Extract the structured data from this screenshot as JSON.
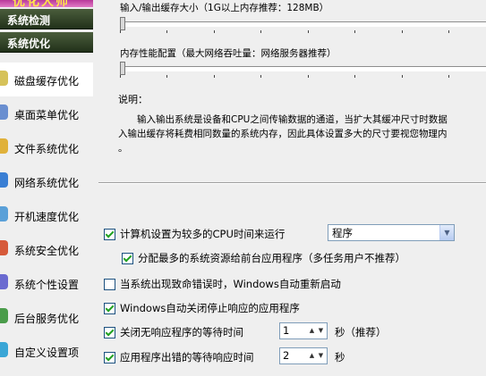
{
  "sidebar": {
    "categories": [
      "系统检测",
      "系统优化"
    ],
    "items": [
      {
        "label": "磁盘缓存优化",
        "icon": "disk-icon",
        "color": "#d6c25a"
      },
      {
        "label": "桌面菜单优化",
        "icon": "desktop-icon",
        "color": "#6a8fd0"
      },
      {
        "label": "文件系统优化",
        "icon": "folder-icon",
        "color": "#e0b13a"
      },
      {
        "label": "网络系统优化",
        "icon": "globe-icon",
        "color": "#3a7fd4"
      },
      {
        "label": "开机速度优化",
        "icon": "power-icon",
        "color": "#5aa0d8"
      },
      {
        "label": "系统安全优化",
        "icon": "shield-icon",
        "color": "#d65a3a"
      },
      {
        "label": "系统个性设置",
        "icon": "user-icon",
        "color": "#6a6ad0"
      },
      {
        "label": "后台服务优化",
        "icon": "service-icon",
        "color": "#4a9c4a"
      },
      {
        "label": "自定义设置项",
        "icon": "gear-icon",
        "color": "#3aa6d6"
      }
    ],
    "active_index": 0
  },
  "main": {
    "io_cache_label": "输入/输出缓存大小（1G以上内存推荐：128MB）",
    "mem_perf_label": "内存性能配置（最大网络吞吐量：网络服务器推荐）",
    "description_label": "说明：",
    "description_lines": [
      "　　输入输出系统是设备和CPU之间传输数据的通道，当扩大其缓冲尺寸时数据",
      "入输出缓存将耗费相同数量的系统内存，因此具体设置多大的尺寸要视您物理内",
      "。"
    ],
    "cpu_time_label": "计算机设置为较多的CPU时间来运行",
    "cpu_time_value": "程序",
    "foreground_label": "分配最多的系统资源给前台应用程序（多任务用户不推荐）",
    "auto_restart_label": "当系统出现致命错误时，Windows自动重新启动",
    "auto_close_label": "Windows自动关闭停止响应的应用程序",
    "close_wait_label": "关闭无响应程序的等待时间",
    "close_wait_value": "1",
    "close_wait_unit": "秒（推荐）",
    "error_wait_label": "应用程序出错的等待响应时间",
    "error_wait_value": "2",
    "error_wait_unit": "秒",
    "io_cache_level": 0,
    "mem_perf_level": 0
  }
}
